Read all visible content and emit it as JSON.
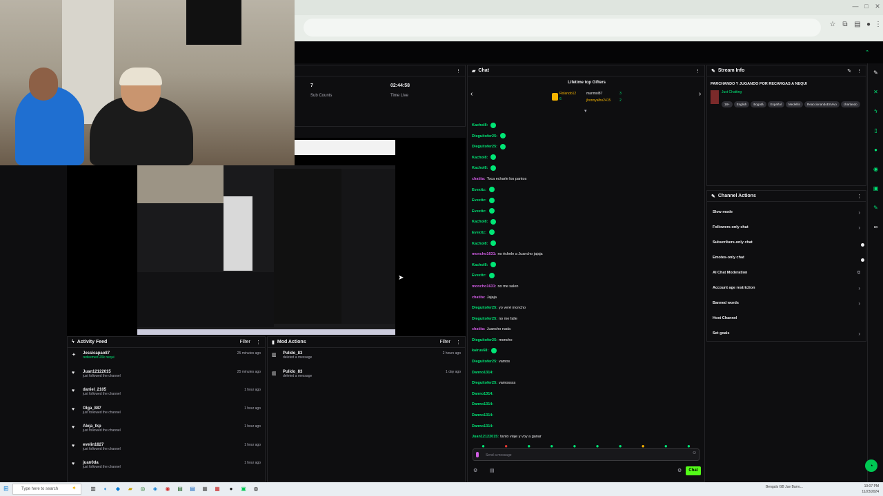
{
  "browser": {
    "title": "",
    "address": ""
  },
  "stats": [
    {
      "value": "7",
      "label": "Sub Counts"
    },
    {
      "value": "02:44:58",
      "label": "Time Live"
    }
  ],
  "activity": {
    "title": "Activity Feed",
    "filter": "Filter",
    "items": [
      {
        "icon": "gift-icon",
        "name": "Jessicapao87",
        "action": "redeemed 20k nequi",
        "time": "25 minutes ago",
        "green": true
      },
      {
        "icon": "heart-icon",
        "name": "Juan12122015",
        "action": "just followed the channel",
        "time": "25 minutes ago",
        "green": false
      },
      {
        "icon": "heart-icon",
        "name": "daniel_2105",
        "action": "just followed the channel",
        "time": "1 hour ago",
        "green": false
      },
      {
        "icon": "heart-icon",
        "name": "Olga_887",
        "action": "just followed the channel",
        "time": "1 hour ago",
        "green": false
      },
      {
        "icon": "heart-icon",
        "name": "Aleja_tkp",
        "action": "just followed the channel",
        "time": "1 hour ago",
        "green": false
      },
      {
        "icon": "heart-icon",
        "name": "evelin1827",
        "action": "just followed the channel",
        "time": "1 hour ago",
        "green": false
      },
      {
        "icon": "heart-icon",
        "name": "juan0da",
        "action": "just followed the channel",
        "time": "1 hour ago",
        "green": false
      }
    ]
  },
  "mod_actions": {
    "title": "Mod Actions",
    "filter": "Filter",
    "items": [
      {
        "name": "Pulido_83",
        "action": "deleted a message",
        "time": "2 hours ago"
      },
      {
        "name": "Pulido_83",
        "action": "deleted a message",
        "time": "1 day ago"
      }
    ]
  },
  "chat": {
    "title": "Chat",
    "gifters_title": "Lifetime top Gifters",
    "gifters": [
      {
        "name": "Rolando12",
        "count": "6"
      },
      {
        "name": "manmol87",
        "count": "3"
      },
      {
        "name": "jhonnyalho2415",
        "count": "2"
      }
    ],
    "messages": [
      {
        "user": "Kachol8:",
        "text": "",
        "color": "#00e676",
        "badge": true
      },
      {
        "user": "Dieguitofer25:",
        "text": "",
        "color": "#00e676",
        "badge": true
      },
      {
        "user": "Dieguitofer25:",
        "text": "",
        "color": "#00e676",
        "badge": true
      },
      {
        "user": "Kachol8:",
        "text": "",
        "color": "#00e676",
        "badge": true
      },
      {
        "user": "Kachol8:",
        "text": "",
        "color": "#00e676",
        "badge": true
      },
      {
        "user": "chatita:",
        "text": "Toca echarle los pantos",
        "color": "#d05ce3",
        "badge": false
      },
      {
        "user": "Evexitz:",
        "text": "",
        "color": "#00e676",
        "badge": true
      },
      {
        "user": "Evexitz:",
        "text": "",
        "color": "#00e676",
        "badge": true
      },
      {
        "user": "Evexitz:",
        "text": "",
        "color": "#00e676",
        "badge": true
      },
      {
        "user": "Kachol8:",
        "text": "",
        "color": "#00e676",
        "badge": true
      },
      {
        "user": "Evexitz:",
        "text": "",
        "color": "#00e676",
        "badge": true
      },
      {
        "user": "Kachol8:",
        "text": "",
        "color": "#00e676",
        "badge": true
      },
      {
        "user": "moncho1631:",
        "text": "no échele a Juancho jajaja",
        "color": "#d05ce3",
        "badge": false
      },
      {
        "user": "Kachol8:",
        "text": "",
        "color": "#00e676",
        "badge": true
      },
      {
        "user": "Evexitz:",
        "text": "",
        "color": "#00e676",
        "badge": true
      },
      {
        "user": "moncho1631:",
        "text": "no me salen",
        "color": "#d05ce3",
        "badge": false
      },
      {
        "user": "chatita:",
        "text": "Jajaja",
        "color": "#d05ce3",
        "badge": false
      },
      {
        "user": "Dieguitofer25:",
        "text": "yo veré moncho",
        "color": "#00e676",
        "badge": false
      },
      {
        "user": "Dieguitofer25:",
        "text": "no me falle",
        "color": "#00e676",
        "badge": false
      },
      {
        "user": "chatita:",
        "text": "Juancho nada",
        "color": "#d05ce3",
        "badge": false
      },
      {
        "user": "Dieguitofer25:",
        "text": "moncho",
        "color": "#00e676",
        "badge": false
      },
      {
        "user": "kairus68:",
        "text": "",
        "color": "#00e676",
        "badge": true
      },
      {
        "user": "Dieguitofer25:",
        "text": "vamos",
        "color": "#00e676",
        "badge": false
      },
      {
        "user": "Danno1314:",
        "text": "",
        "color": "#00e676",
        "badge": false
      },
      {
        "user": "Dieguitofer25:",
        "text": "vamossss",
        "color": "#00e676",
        "badge": false
      },
      {
        "user": "Danno1314:",
        "text": "",
        "color": "#00e676",
        "badge": false
      },
      {
        "user": "Danno1314:",
        "text": "",
        "color": "#00e676",
        "badge": false
      },
      {
        "user": "Danno1314:",
        "text": "",
        "color": "#00e676",
        "badge": false
      },
      {
        "user": "Danno1314:",
        "text": "",
        "color": "#00e676",
        "badge": false
      },
      {
        "user": "Juan12122015:",
        "text": "tanto viaje y voy a ganar",
        "color": "#00e676",
        "badge": false
      }
    ],
    "input_placeholder": "Send a message",
    "send_label": "Chat"
  },
  "stream_info": {
    "title": "Stream Info",
    "stream_title": "PARCHANDO Y JUGANDO POR RECARGAS A NEQUI",
    "category": "Just Chatting",
    "tags": [
      "18+",
      "English",
      "Bogotá",
      "Español",
      "Medellín",
      "ReaccionandoEnVivo",
      "charlando"
    ]
  },
  "channel_actions": {
    "title": "Channel Actions",
    "items": [
      {
        "label": "Slow mode",
        "control": "chevron"
      },
      {
        "label": "Followers-only chat",
        "control": "chevron"
      },
      {
        "label": "Subscribers-only chat",
        "control": "toggle"
      },
      {
        "label": "Emotes-only chat",
        "control": "toggle"
      },
      {
        "label": "AI Chat Moderation",
        "control": "external"
      },
      {
        "label": "Account age restriction",
        "control": "chevron"
      },
      {
        "label": "Banned words",
        "control": "chevron"
      },
      {
        "label": "Host Channel",
        "control": "none"
      },
      {
        "label": "Set goals",
        "control": "chevron"
      }
    ]
  },
  "taskbar": {
    "search_placeholder": "Type here to search",
    "tray_text": "Bengals GB Jue Barro...",
    "time": "10:07 PM",
    "date": "11/23/2024"
  },
  "colors": {
    "accent": "#53fc18",
    "panel": "#0e0e10",
    "green": "#00e676"
  }
}
